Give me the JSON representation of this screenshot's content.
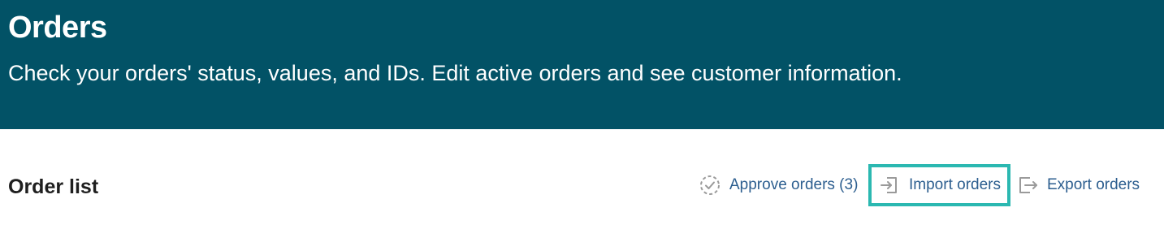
{
  "header": {
    "title": "Orders",
    "subtitle": "Check your orders' status, values, and IDs. Edit active orders and see customer information.",
    "background_color": "#025266"
  },
  "order_list": {
    "title": "Order list",
    "actions": [
      {
        "label": "Approve orders (3)",
        "icon": "approve-check-circle-icon"
      },
      {
        "label": "Import orders",
        "icon": "import-icon",
        "highlighted": true,
        "highlight_color": "#2bb8b1"
      },
      {
        "label": "Export orders",
        "icon": "export-icon"
      }
    ],
    "link_color": "#2c5e8f"
  }
}
